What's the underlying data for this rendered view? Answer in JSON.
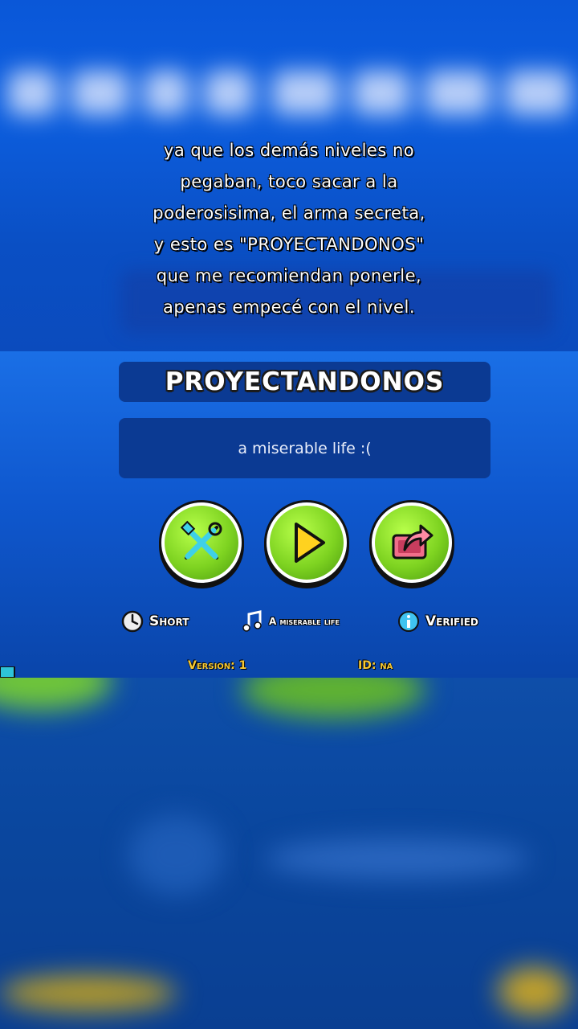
{
  "caption": {
    "line1": "ya que los demás niveles no",
    "line2": "pegaban, toco sacar a la",
    "line3": "poderosisima, el arma secreta,",
    "line4": "y esto es \"PROYECTANDONOS\"",
    "line5": "que me recomiendan ponerle,",
    "line6": "apenas empecé con el nivel."
  },
  "level": {
    "title": "PROYECTANDONOS",
    "description": "a miserable life :("
  },
  "buttons": {
    "edit": "edit-icon",
    "play": "play-icon",
    "share": "share-icon"
  },
  "info": {
    "length": "Short",
    "song": "A miserable life",
    "status": "Verified"
  },
  "meta": {
    "version": "Version: 1",
    "id": "ID: na"
  },
  "colors": {
    "accent_green": "#7ed321",
    "panel_blue": "#0b3a93",
    "meta_yellow": "#f7c934"
  }
}
